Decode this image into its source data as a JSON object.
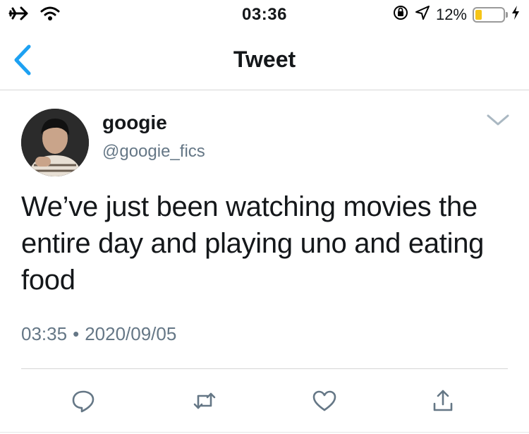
{
  "status_bar": {
    "time": "03:36",
    "battery_percent": "12%",
    "battery_level": 0.12,
    "icons": [
      "airplane-icon",
      "wifi-icon",
      "orientation-lock-icon",
      "location-icon",
      "battery-icon",
      "charging-icon"
    ]
  },
  "nav": {
    "title": "Tweet",
    "back_icon": "chevron-left-icon"
  },
  "tweet": {
    "display_name": "googie",
    "handle": "@googie_fics",
    "text": "We’ve just been watching movies the entire day and playing uno and eating food",
    "time": "03:35",
    "separator": "•",
    "date": "2020/09/05",
    "menu_icon": "chevron-down-icon"
  },
  "actions": {
    "reply_icon": "reply-icon",
    "retweet_icon": "retweet-icon",
    "like_icon": "heart-icon",
    "share_icon": "share-icon"
  },
  "colors": {
    "accent": "#1da1f2",
    "text_primary": "#14171a",
    "text_secondary": "#657786",
    "icon_gray": "#657786",
    "divider": "#d6d6d6",
    "battery": "#f5c518"
  }
}
